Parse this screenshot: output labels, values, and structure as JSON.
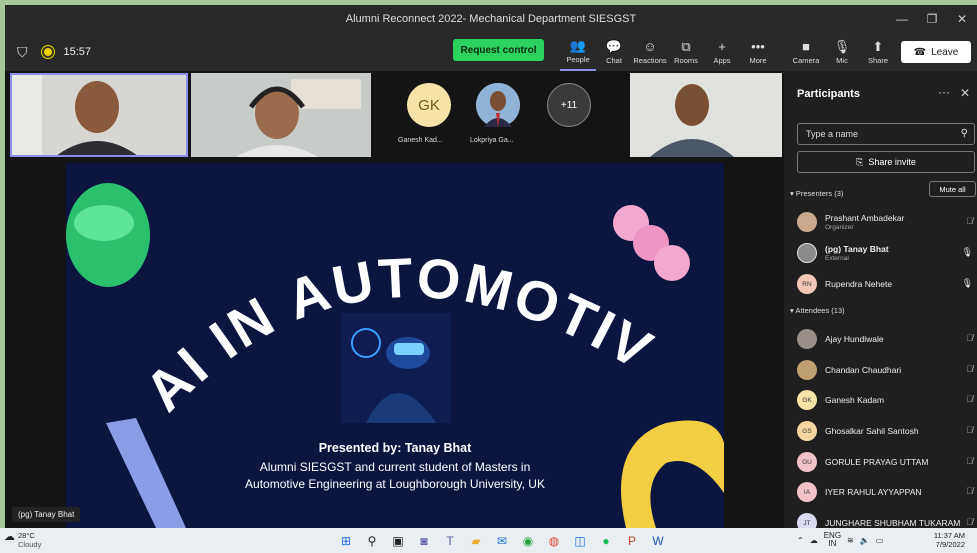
{
  "window": {
    "title": "Alumni Reconnect 2022- Mechanical Department SIESGST",
    "minimize": "—",
    "restore": "❐",
    "close": "✕"
  },
  "toolbar": {
    "time": "15:57",
    "request_control": "Request control",
    "tools": [
      {
        "label": "People",
        "icon": "👥"
      },
      {
        "label": "Chat",
        "icon": "💬"
      },
      {
        "label": "Reactions",
        "icon": "☺"
      },
      {
        "label": "Rooms",
        "icon": "⧉"
      },
      {
        "label": "Apps",
        "icon": "+"
      },
      {
        "label": "More",
        "icon": "•••"
      },
      {
        "label": "Camera",
        "icon": "■"
      },
      {
        "label": "Mic",
        "icon": "🎙"
      },
      {
        "label": "Share",
        "icon": "⬆"
      }
    ],
    "leave": "Leave"
  },
  "stage": {
    "avatars": [
      {
        "initials": "GK",
        "label": "Ganesh Kad...",
        "color": "#f5e3a8"
      },
      {
        "initials": "",
        "label": "Lokpriya Ga...",
        "color": "#b5b5b5"
      },
      {
        "initials": "+11",
        "label": "",
        "color": "#3a3a3a"
      }
    ],
    "slide": {
      "title": "AI IN AUTOMOTIVE",
      "presented_by": "Presented by: Tanay Bhat",
      "line1": "Alumni SIESGST and current student of Masters in",
      "line2": "Automotive Engineering at Loughborough University, UK"
    },
    "presenter_label": "(pg) Tanay Bhat"
  },
  "panel": {
    "title": "Participants",
    "more": "···",
    "close": "✕",
    "search_placeholder": "Type a name",
    "share_invite": "Share invite",
    "presenters_heading": "Presenters (3)",
    "mute_all": "Mute all",
    "presenters": [
      {
        "name": "Prashant Ambadekar",
        "sub": "Organizer",
        "initials": "",
        "color": "#c9a98e",
        "mic": "🎙̸"
      },
      {
        "name": "(pg) Tanay Bhat",
        "sub": "External",
        "initials": "",
        "color": "#8a8a8a",
        "mic": "🎙"
      },
      {
        "name": "Rupendra Nehete",
        "sub": "",
        "initials": "RN",
        "color": "#f4c7b8",
        "mic": "🎙"
      }
    ],
    "attendees_heading": "Attendees (13)",
    "attendees": [
      {
        "name": "Ajay Hundiwale",
        "initials": "",
        "color": "#9a8f88",
        "mic": "🎙̸"
      },
      {
        "name": "Chandan Chaudhari",
        "initials": "",
        "color": "#c0a070",
        "mic": "🎙̸"
      },
      {
        "name": "Ganesh Kadam",
        "initials": "GK",
        "color": "#f5e3a8",
        "mic": "🎙̸"
      },
      {
        "name": "Ghosalkar Sahil Santosh",
        "initials": "GS",
        "color": "#f5d6a0",
        "mic": "🎙̸"
      },
      {
        "name": "GORULE PRAYAG UTTAM",
        "initials": "GU",
        "color": "#f3c1c8",
        "mic": "🎙̸"
      },
      {
        "name": "IYER RAHUL AYYAPPAN",
        "initials": "IA",
        "color": "#f3c1c8",
        "mic": "🎙̸"
      },
      {
        "name": "JUNGHARE SHUBHAM TUKARAM",
        "initials": "JT",
        "color": "#d9d9ef",
        "mic": "🎙̸"
      }
    ]
  },
  "taskbar": {
    "temp": "28°C",
    "weather": "Cloudy",
    "lang1": "ENG",
    "lang2": "IN",
    "time": "11:37 AM",
    "date": "7/9/2022"
  }
}
